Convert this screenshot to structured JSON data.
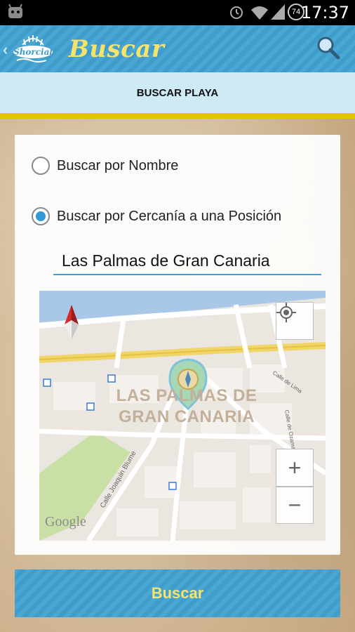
{
  "status_bar": {
    "time": "17:37",
    "battery": "74"
  },
  "app": {
    "title": "Buscar",
    "logo_text": "Shorcial"
  },
  "sub_header": {
    "label": "BUSCAR PLAYA"
  },
  "options": [
    {
      "label": "Buscar por Nombre",
      "checked": false
    },
    {
      "label": "Buscar por Cercanía a una Posición",
      "checked": true
    }
  ],
  "location_input": {
    "value": "Las Palmas de Gran Canaria"
  },
  "map": {
    "city_label_line1": "LAS PALMAS DE",
    "city_label_line2": "GRAN CANARIA",
    "street_1": "Calle Joaquin Blume",
    "street_2": "Calle de Lima",
    "street_3": "Calle de Ozama",
    "zoom_in": "+",
    "zoom_out": "−",
    "attribution": "Google"
  },
  "search_button": {
    "label": "Buscar"
  },
  "colors": {
    "accent": "#4aa6d3",
    "title": "#f6e36b",
    "underline": "#e3c200",
    "radio_selected": "#2f9ad6"
  }
}
